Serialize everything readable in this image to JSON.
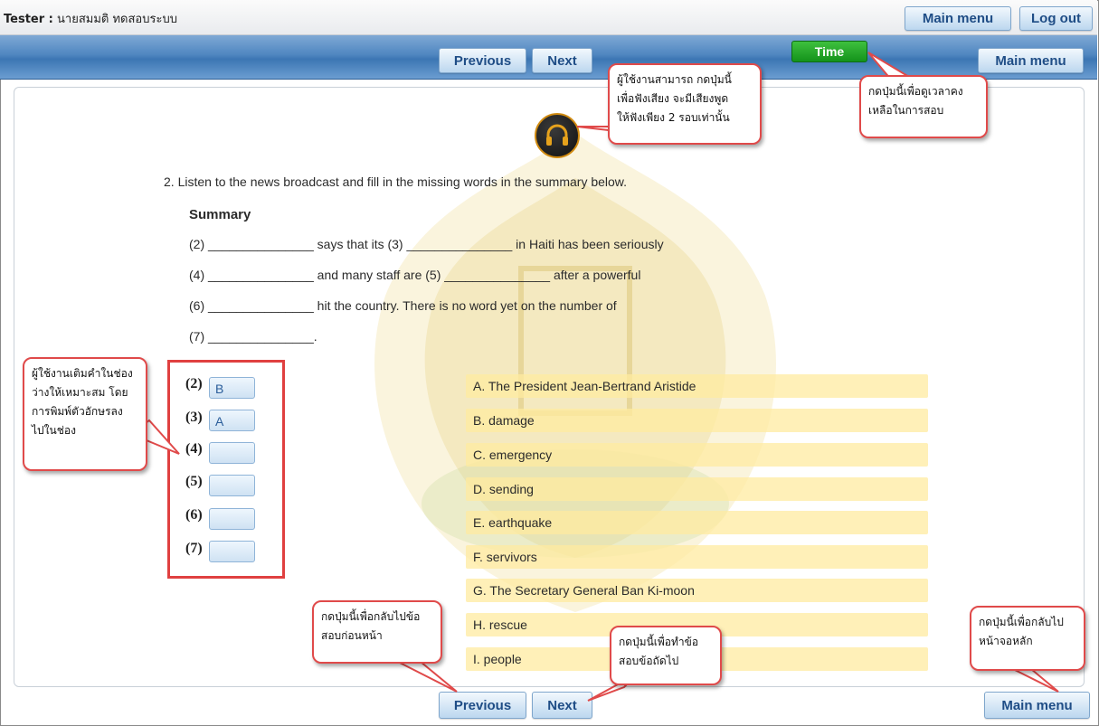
{
  "header": {
    "tester_label": "Tester :",
    "tester_name": "นายสมมติ ทดสอบระบบ",
    "main_menu_label": "Main menu",
    "logout_label": "Log out"
  },
  "navbar": {
    "previous_label": "Previous",
    "next_label": "Next",
    "time_label": "Time",
    "main_menu_label": "Main menu"
  },
  "audio": {
    "icon": "headphones-icon"
  },
  "question": {
    "text": "2.  Listen to the news broadcast and fill in the missing words in the summary below.",
    "summary_title": "Summary",
    "lines": [
      "(2) _______________ says that its (3) _______________ in Haiti has been seriously",
      "(4) _______________ and many staff are (5) _______________ after a powerful",
      "(6) _______________ hit the country. There is no word yet on the number of",
      "(7) _______________."
    ]
  },
  "answers": [
    {
      "label": "(2)",
      "value": "B"
    },
    {
      "label": "(3)",
      "value": "A"
    },
    {
      "label": "(4)",
      "value": ""
    },
    {
      "label": "(5)",
      "value": ""
    },
    {
      "label": "(6)",
      "value": ""
    },
    {
      "label": "(7)",
      "value": ""
    }
  ],
  "options": [
    "A. The President Jean-Bertrand Aristide",
    "B. damage",
    "C. emergency",
    "D. sending",
    "E. earthquake",
    "F. servivors",
    "G. The Secretary General Ban Ki-moon",
    "H. rescue",
    "I. people"
  ],
  "footer": {
    "previous_label": "Previous",
    "next_label": "Next",
    "main_menu_label": "Main menu"
  },
  "callouts": {
    "audio": [
      "ผู้ใช้งานสามารถ กดปุ่มนี้",
      "เพื่อฟังเสียง จะมีเสียงพูด",
      "ให้ฟังเพียง 2 รอบเท่านั้น"
    ],
    "time": [
      "กดปุ่มนี้เพื่อดูเวลาคง",
      "เหลือในการสอบ"
    ],
    "fill": [
      "ผู้ใช้งานเติมคำในช่อง",
      "ว่างให้เหมาะสม โดย",
      "การพิมพ์ตัวอักษรลง",
      "ไปในช่อง"
    ],
    "previous": [
      "กดปุ่มนี้เพื่อกลับไปข้อ",
      "สอบก่อนหน้า"
    ],
    "next": [
      "กดปุ่มนี้เพื่อทำข้อ",
      "สอบข้อถัดไป"
    ],
    "main_menu": [
      "กดปุ่มนี้เพื่อกลับไป",
      "หน้าจอหลัก"
    ]
  },
  "colors": {
    "accent_blue": "#4f86c0",
    "time_green": "#14931b",
    "callout_red": "#e04a4a",
    "option_bg": "#ffeba0"
  }
}
